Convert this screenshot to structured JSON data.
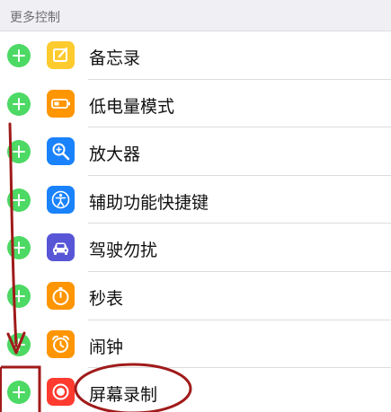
{
  "section": {
    "title": "更多控制"
  },
  "rows": [
    {
      "label": "备忘录",
      "icon": "notes-icon",
      "color": "#fecb2f"
    },
    {
      "label": "低电量模式",
      "icon": "battery-icon",
      "color": "#ff9500"
    },
    {
      "label": "放大器",
      "icon": "magnifier-icon",
      "color": "#1a82fb"
    },
    {
      "label": "辅助功能快捷键",
      "icon": "accessibility-icon",
      "color": "#1a82fb"
    },
    {
      "label": "驾驶勿扰",
      "icon": "car-icon",
      "color": "#5856d6"
    },
    {
      "label": "秒表",
      "icon": "stopwatch-icon",
      "color": "#ff9500"
    },
    {
      "label": "闹钟",
      "icon": "alarm-clock-icon",
      "color": "#ff9500"
    },
    {
      "label": "屏幕录制",
      "icon": "screen-record-icon",
      "color": "#ff3b30"
    }
  ],
  "colors": {
    "add_button": "#4cd964",
    "annotation": "#a01a1a",
    "header_bg": "#efeff4"
  }
}
